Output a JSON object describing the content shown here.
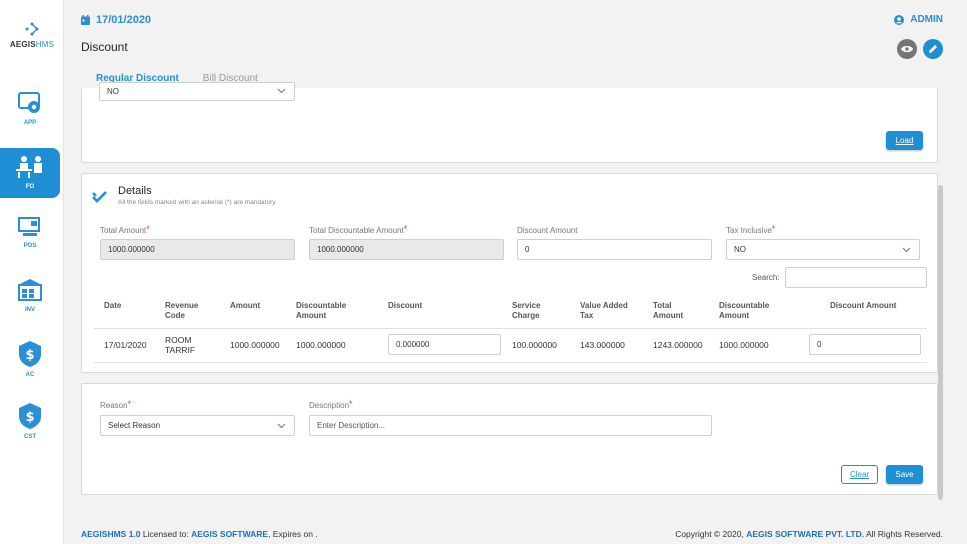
{
  "app": {
    "logo_main": "AEGIS",
    "logo_accent": "HMS"
  },
  "sidebar": {
    "items": [
      {
        "label": "APP",
        "icon": "app-settings-icon"
      },
      {
        "label": "FO",
        "icon": "front-office-icon"
      },
      {
        "label": "POS",
        "icon": "pos-terminal-icon"
      },
      {
        "label": "INV",
        "icon": "inventory-icon"
      },
      {
        "label": "AC",
        "icon": "accounts-icon"
      },
      {
        "label": "CST",
        "icon": "cost-icon"
      }
    ]
  },
  "header": {
    "date": "17/01/2020",
    "user": "ADMIN",
    "page_title": "Discount"
  },
  "tabs": [
    {
      "label": "Regular Discount",
      "active": true
    },
    {
      "label": "Bill Discount",
      "active": false
    }
  ],
  "top_form": {
    "select_value": "NO",
    "load_label": "Load"
  },
  "details": {
    "title": "Details",
    "subtitle": "All the fields marked with an asterisk (*) are mandatory.",
    "total_amount_label": "Total Amount",
    "total_amount_value": "1000.000000",
    "total_disc_label": "Total Discountable Amount",
    "total_disc_value": "1000.000000",
    "discount_amount_label": "Discount Amount",
    "discount_amount_value": "0",
    "tax_inclusive_label": "Tax Inclusive",
    "tax_inclusive_value": "NO",
    "search_label": "Search:",
    "search_value": ""
  },
  "table": {
    "columns": {
      "date": "Date",
      "revenue_code_1": "Revenue",
      "revenue_code_2": "Code",
      "amount": "Amount",
      "discountable_amount_1": "Discountable",
      "discountable_amount_2": "Amount",
      "discount": "Discount",
      "service_charge_1": "Service",
      "service_charge_2": "Charge",
      "vat_1": "Value Added",
      "vat_2": "Tax",
      "total_amount_1": "Total",
      "total_amount_2": "Amount",
      "disc_amount2_1": "Discountable",
      "disc_amount2_2": "Amount",
      "discount_amount": "Discount Amount"
    },
    "rows": [
      {
        "date": "17/01/2020",
        "revenue_code_1": "ROOM",
        "revenue_code_2": "TARRIF",
        "amount": "1000.000000",
        "discountable_amount": "1000.000000",
        "discount": "0.000000",
        "service_charge": "100.000000",
        "vat": "143.000000",
        "total_amount": "1243.000000",
        "discountable_amount2": "1000.000000",
        "discount_amount": "0"
      }
    ]
  },
  "reason_form": {
    "reason_label": "Reason",
    "reason_placeholder": "Select Reason",
    "description_label": "Description",
    "description_placeholder": "Enter Description...",
    "clear_label": "Clear",
    "save_label": "Save"
  },
  "footer": {
    "product": "AEGISHMS 1.0",
    "licensed_to_text": " Licensed to: ",
    "licensee": "AEGIS SOFTWARE",
    "expires_text": ", Expires on .",
    "copyright_text": "Copyright © 2020, ",
    "company": "AEGIS SOFTWARE PVT. LTD.",
    "rights_text": " All Rights Reserved."
  },
  "colors": {
    "accent": "#1e8fd5",
    "required": "#e53935"
  }
}
